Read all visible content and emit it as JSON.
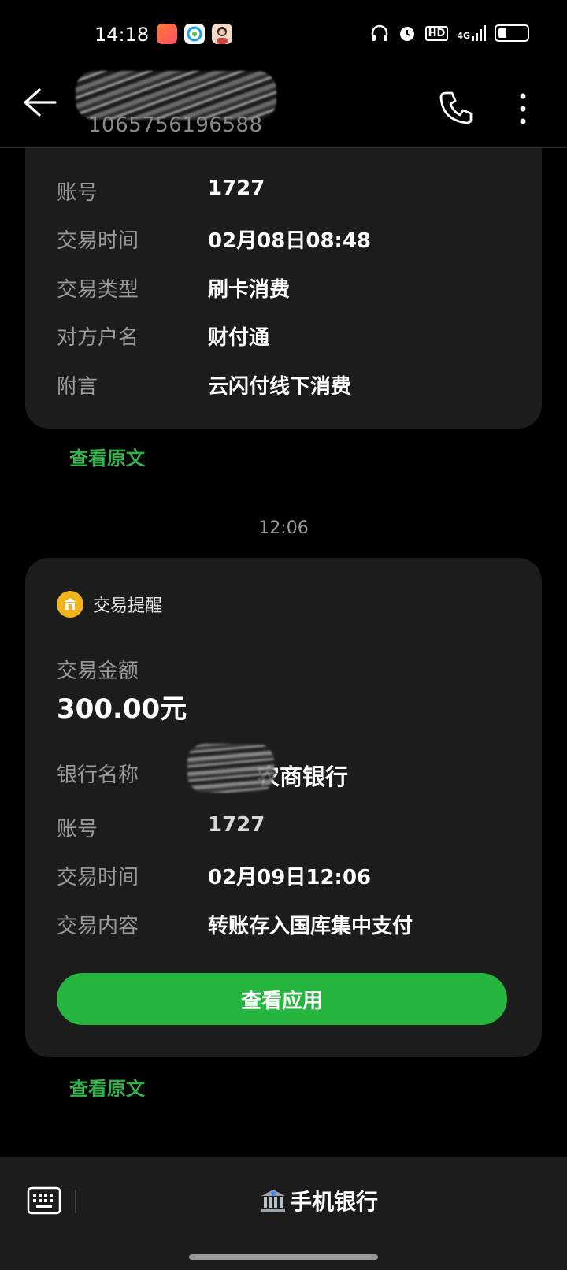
{
  "status_bar": {
    "time": "14:18",
    "app_icons": [
      "video-app-icon",
      "network-app-icon",
      "avatar-app-icon"
    ],
    "indicators": [
      "headphones-icon",
      "alarm-icon",
      "hd-icon",
      "signal-4g-icon",
      "battery-icon"
    ],
    "hd": "HD",
    "network": "4G"
  },
  "header": {
    "sender_number": "1065756196588"
  },
  "card1": {
    "rows": [
      {
        "label": "账号",
        "value": "1727"
      },
      {
        "label": "交易时间",
        "value": "02月08日08:48"
      },
      {
        "label": "交易类型",
        "value": "刷卡消费"
      },
      {
        "label": "对方户名",
        "value": "财付通"
      },
      {
        "label": "附言",
        "value": "云闪付线下消费"
      }
    ],
    "view_original": "查看原文"
  },
  "message_time": "12:06",
  "card2": {
    "title": "交易提醒",
    "amount_label": "交易金额",
    "amount": "300.00元",
    "rows": [
      {
        "label": "银行名称",
        "value": "农商银行"
      },
      {
        "label": "账号",
        "value": "1727"
      },
      {
        "label": "交易时间",
        "value": "02月09日12:06"
      },
      {
        "label": "交易内容",
        "value": "转账存入国库集中支付"
      }
    ],
    "button": "查看应用",
    "view_original": "查看原文"
  },
  "bottom_bar": {
    "menu_label": "手机银行",
    "menu_icon": "bank-icon"
  },
  "colors": {
    "accent_green": "#26b53f",
    "link_green": "#2fb34a",
    "card_bg": "#1c1c1c",
    "badge_yellow": "#f0b51c"
  }
}
